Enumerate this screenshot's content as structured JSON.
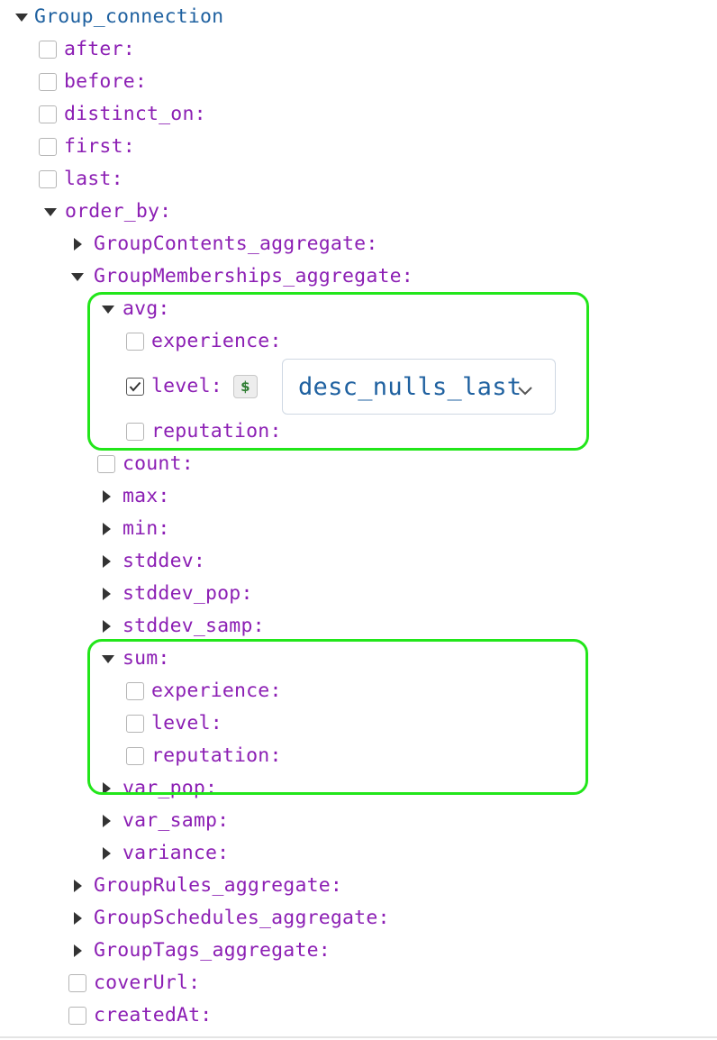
{
  "tree": {
    "root": "Group_connection",
    "after": "after:",
    "before": "before:",
    "distinct_on": "distinct_on:",
    "first": "first:",
    "last": "last:",
    "order_by": "order_by:",
    "group_contents": "GroupContents_aggregate:",
    "group_memberships": "GroupMemberships_aggregate:",
    "avg": {
      "label": "avg:",
      "experience": "experience:",
      "level": "level:",
      "level_checked": true,
      "variable_button": "$",
      "level_value": "desc_nulls_last",
      "reputation": "reputation:"
    },
    "count": "count:",
    "max": "max:",
    "min": "min:",
    "stddev": "stddev:",
    "stddev_pop": "stddev_pop:",
    "stddev_samp": "stddev_samp:",
    "sum": {
      "label": "sum:",
      "experience": "experience:",
      "level": "level:",
      "reputation": "reputation:"
    },
    "var_pop": "var_pop:",
    "var_samp": "var_samp:",
    "variance": "variance:",
    "group_rules": "GroupRules_aggregate:",
    "group_schedules": "GroupSchedules_aggregate:",
    "group_tags": "GroupTags_aggregate:",
    "cover_url": "coverUrl:",
    "created_at": "createdAt:"
  },
  "icons": {
    "expanded": "caret-down-icon",
    "collapsed": "caret-right-icon",
    "dropdown": "chevron-down-icon",
    "checked": "checkmark-icon"
  },
  "colors": {
    "root_label": "#1f61a0",
    "field_label": "#8c1fb4",
    "highlight": "#22e61a",
    "select_value": "#1f61a0",
    "variable_symbol": "#2e7d32"
  }
}
